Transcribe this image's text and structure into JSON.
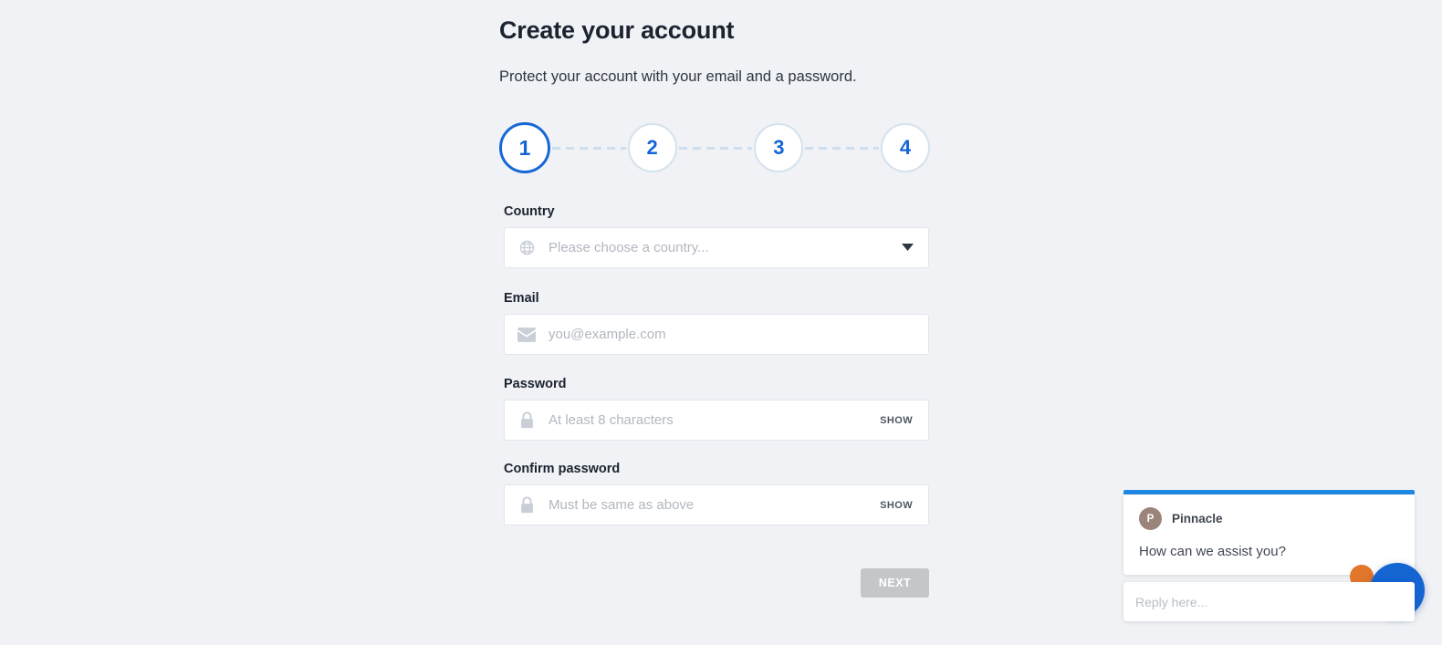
{
  "page": {
    "title": "Create your account",
    "subtitle": "Protect your account with your email and a password.",
    "background_color": "#f0f2f5"
  },
  "stepper": {
    "active_step": 1,
    "active_color": "#1668d6",
    "inactive_border_color": "#d3e2ee",
    "steps": [
      {
        "label": "1"
      },
      {
        "label": "2"
      },
      {
        "label": "3"
      },
      {
        "label": "4"
      }
    ]
  },
  "form": {
    "country": {
      "label": "Country",
      "placeholder": "Please choose a country...",
      "value": "",
      "icon": "globe-icon",
      "dropdown_icon": "chevron-down-icon"
    },
    "email": {
      "label": "Email",
      "placeholder": "you@example.com",
      "value": "",
      "icon": "envelope-icon"
    },
    "password": {
      "label": "Password",
      "placeholder": "At least 8 characters",
      "value": "",
      "icon": "lock-icon",
      "show_label": "SHOW"
    },
    "confirm_password": {
      "label": "Confirm password",
      "placeholder": "Must be same as above",
      "value": "",
      "icon": "lock-icon",
      "show_label": "SHOW"
    },
    "next_button": {
      "label": "NEXT",
      "enabled": false,
      "color": "#c4c6c9"
    }
  },
  "chat_widget": {
    "accent_color": "#1e88e5",
    "agent": {
      "avatar_initial": "P",
      "avatar_color": "#9b8479",
      "name": "Pinnacle"
    },
    "message": "How can we assist you?",
    "reply_placeholder": "Reply here...",
    "launcher": {
      "color": "#1464d2",
      "accent_color": "#e2762a"
    }
  }
}
